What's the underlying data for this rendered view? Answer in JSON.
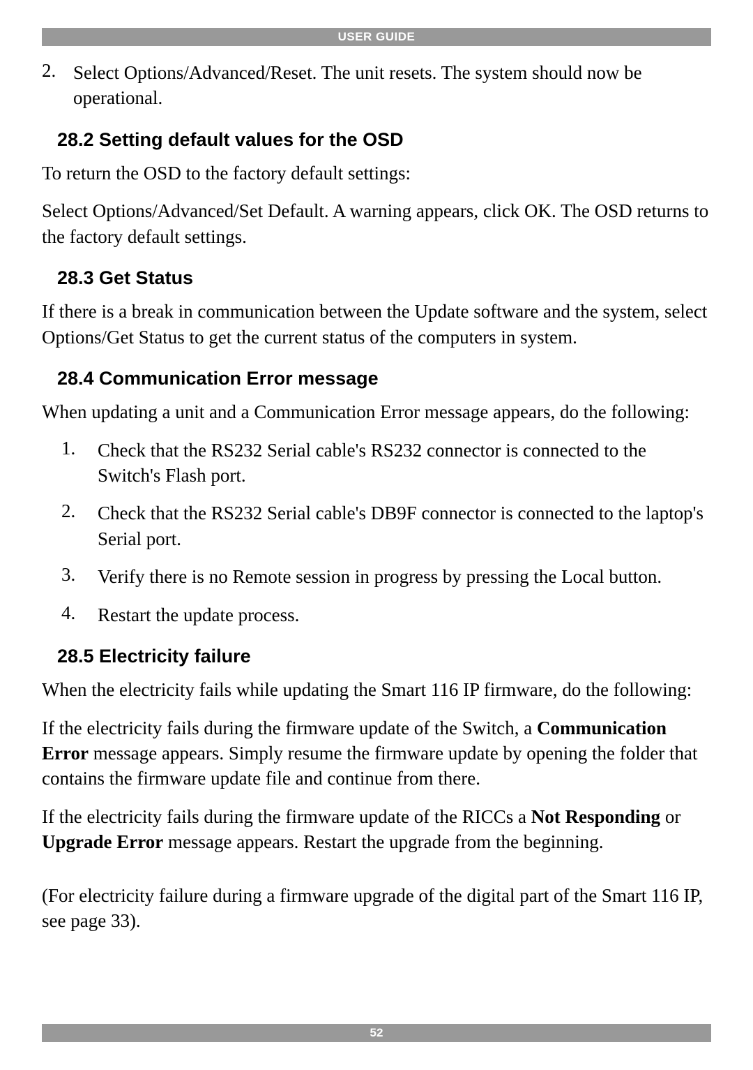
{
  "header": {
    "title": "USER GUIDE"
  },
  "intro": {
    "item2_num": "2.",
    "item2_text": "Select Options/Advanced/Reset. The unit resets. The system should now be operational."
  },
  "section_282": {
    "heading": "28.2 Setting default values for the OSD",
    "p1": "To return the OSD to the factory default settings:",
    "p2": "Select Options/Advanced/Set Default. A warning appears, click OK. The OSD returns to the factory default settings."
  },
  "section_283": {
    "heading": "28.3 Get Status",
    "p1": "If there is a break in communication between the Update software and the system, select Options/Get Status to get the current status of the computers in system."
  },
  "section_284": {
    "heading": "28.4 Communication Error message",
    "p1": "When updating a unit and a Communication Error message appears, do the following:",
    "steps": [
      {
        "num": "1.",
        "text": "Check that the RS232 Serial cable's RS232 connector is connected to the Switch's Flash port."
      },
      {
        "num": "2.",
        "text": "Check that the RS232 Serial cable's DB9F connector is connected to the laptop's Serial port."
      },
      {
        "num": "3.",
        "text": "Verify there is no Remote session in progress by pressing the Local button."
      },
      {
        "num": "4.",
        "text": "Restart the update process."
      }
    ]
  },
  "section_285": {
    "heading": "28.5 Electricity failure",
    "p1": "When the electricity fails while updating the Smart 116 IP firmware, do the following:",
    "p2_pre": "If the electricity fails during the firmware update of the Switch, a ",
    "p2_bold": "Communication Error",
    "p2_post": " message appears. Simply resume the firmware update by opening the folder that contains the firmware update file and continue from there.",
    "p3_pre": "If the electricity fails during the firmware update of the RICCs a ",
    "p3_bold1": "Not Responding",
    "p3_mid": " or ",
    "p3_bold2": "Upgrade Error",
    "p3_post": " message appears. Restart the upgrade from the beginning.",
    "p4": "(For electricity failure during a firmware upgrade of the digital part of the Smart 116 IP, see page 33)."
  },
  "footer": {
    "page_number": "52"
  }
}
